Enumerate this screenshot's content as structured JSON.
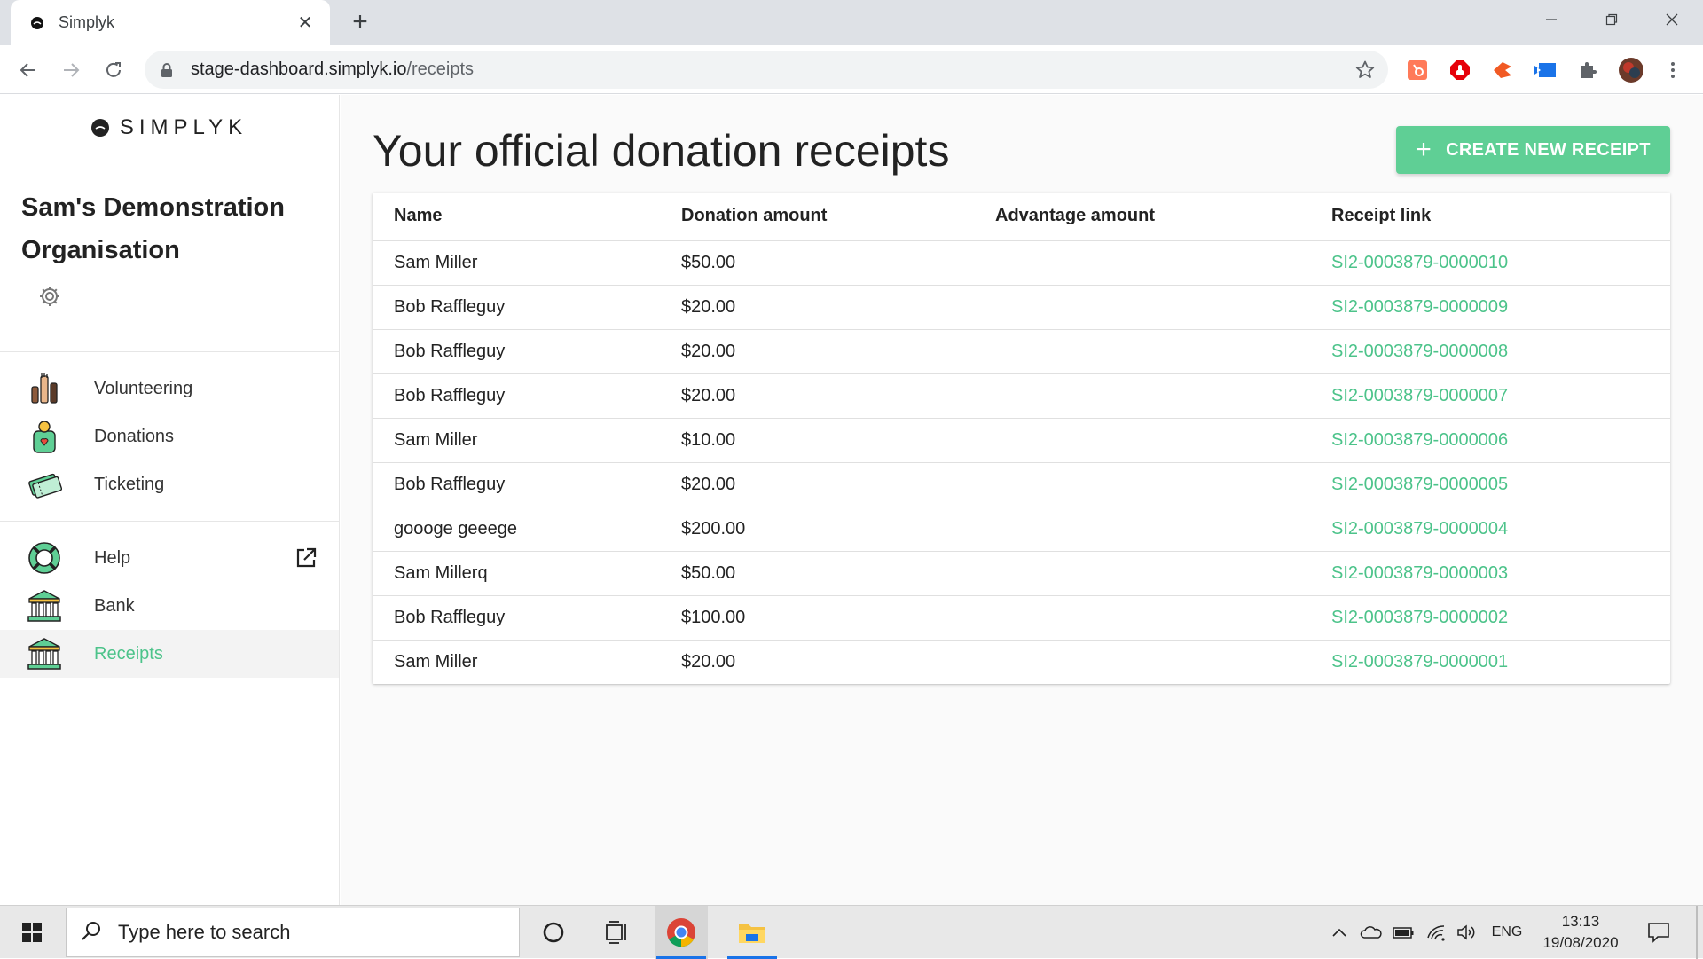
{
  "browser": {
    "tab_title": "Simplyk",
    "url_host": "stage-dashboard.simplyk.io",
    "url_path": "/receipts",
    "extensions": [
      "hubspot-icon",
      "adblock-icon",
      "falcon-icon",
      "screencast-icon",
      "puzzle-icon",
      "profile-avatar"
    ]
  },
  "sidebar": {
    "brand": "SIMPLYK",
    "org_name_line1": "Sam's Demonstration",
    "org_name_line2": "Organisation",
    "primary_items": [
      {
        "label": "Volunteering",
        "icon": "hands-icon"
      },
      {
        "label": "Donations",
        "icon": "donation-jar-icon"
      },
      {
        "label": "Ticketing",
        "icon": "tickets-icon"
      }
    ],
    "secondary_items": [
      {
        "label": "Help",
        "icon": "lifebuoy-icon"
      },
      {
        "label": "Bank",
        "icon": "bank-icon"
      },
      {
        "label": "Receipts",
        "icon": "bank-icon",
        "active": true
      }
    ]
  },
  "main": {
    "title": "Your official donation receipts",
    "create_button": "CREATE NEW RECEIPT",
    "columns": [
      "Name",
      "Donation amount",
      "Advantage amount",
      "Receipt link"
    ],
    "rows": [
      {
        "name": "Sam Miller",
        "donation": "$50.00",
        "advantage": "",
        "link": "SI2-0003879-0000010"
      },
      {
        "name": "Bob Raffleguy",
        "donation": "$20.00",
        "advantage": "",
        "link": "SI2-0003879-0000009"
      },
      {
        "name": "Bob Raffleguy",
        "donation": "$20.00",
        "advantage": "",
        "link": "SI2-0003879-0000008"
      },
      {
        "name": "Bob Raffleguy",
        "donation": "$20.00",
        "advantage": "",
        "link": "SI2-0003879-0000007"
      },
      {
        "name": "Sam Miller",
        "donation": "$10.00",
        "advantage": "",
        "link": "SI2-0003879-0000006"
      },
      {
        "name": "Bob Raffleguy",
        "donation": "$20.00",
        "advantage": "",
        "link": "SI2-0003879-0000005"
      },
      {
        "name": "goooge geeege",
        "donation": "$200.00",
        "advantage": "",
        "link": "SI2-0003879-0000004"
      },
      {
        "name": "Sam Millerq",
        "donation": "$50.00",
        "advantage": "",
        "link": "SI2-0003879-0000003"
      },
      {
        "name": "Bob Raffleguy",
        "donation": "$100.00",
        "advantage": "",
        "link": "SI2-0003879-0000002"
      },
      {
        "name": "Sam Miller",
        "donation": "$20.00",
        "advantage": "",
        "link": "SI2-0003879-0000001"
      }
    ]
  },
  "taskbar": {
    "search_placeholder": "Type here to search",
    "language": "ENG",
    "time": "13:13",
    "date": "19/08/2020"
  },
  "colors": {
    "accent_green": "#4cc38a",
    "button_green": "#5fcf95"
  }
}
